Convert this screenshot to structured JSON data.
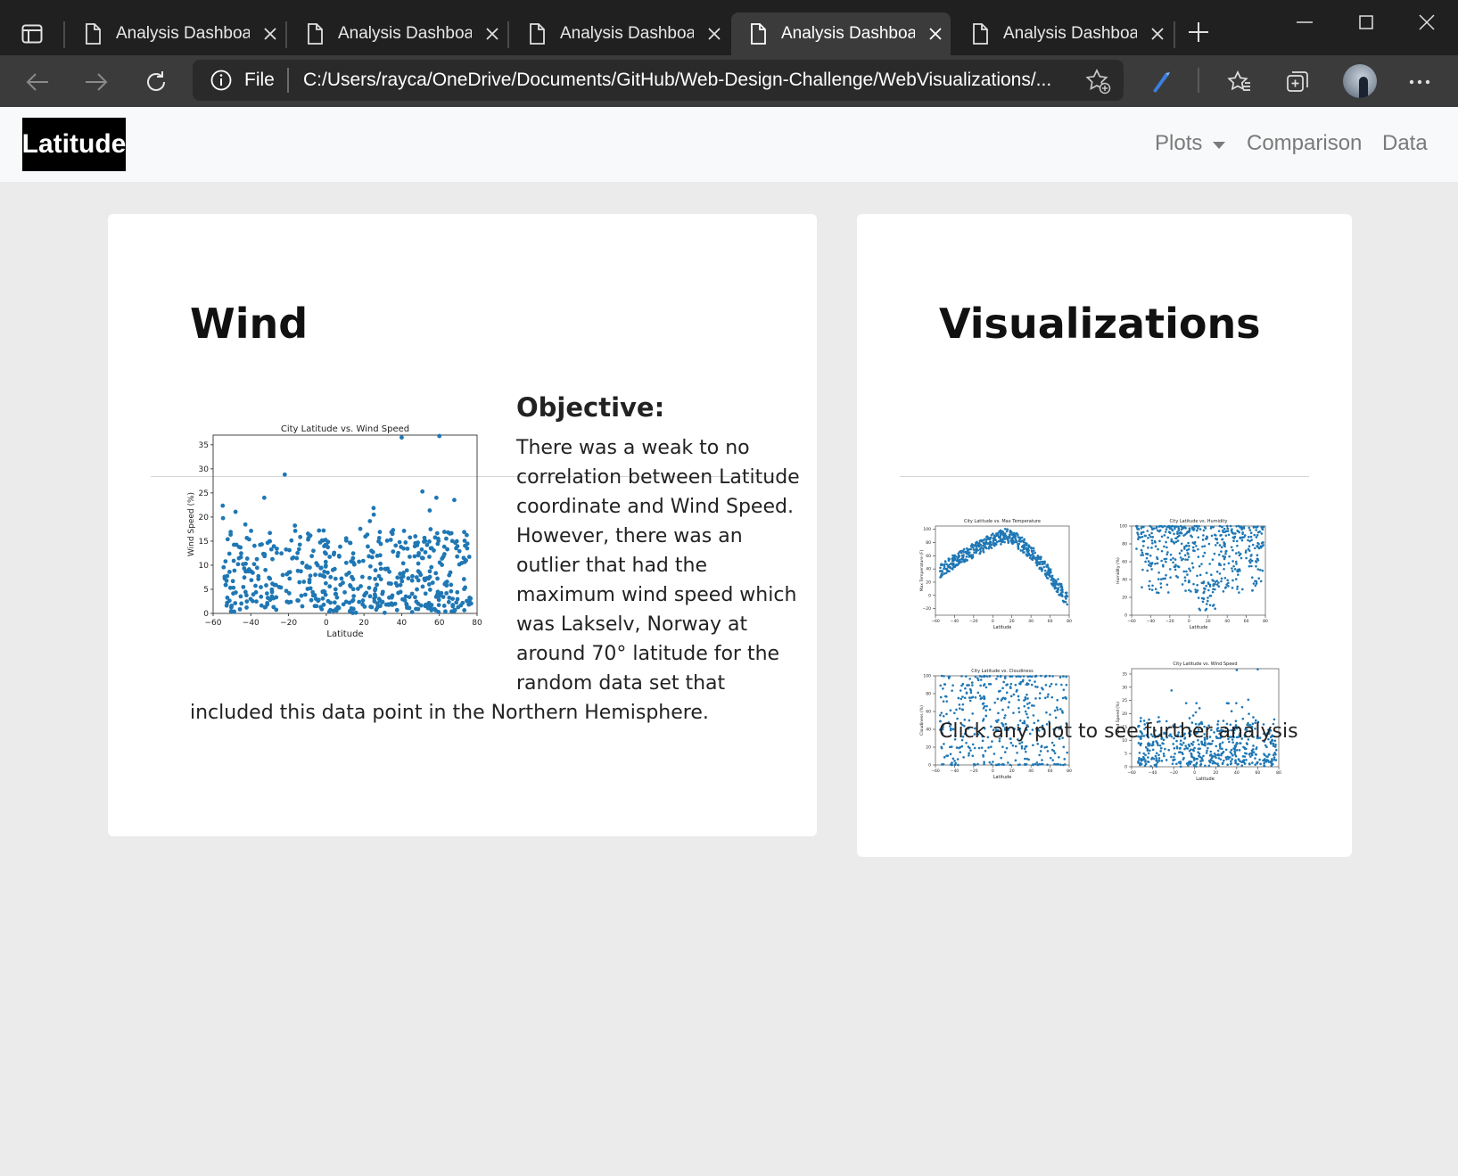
{
  "browser": {
    "tabs": [
      {
        "title": "Analysis Dashboard",
        "active": false
      },
      {
        "title": "Analysis Dashboard",
        "active": false
      },
      {
        "title": "Analysis Dashboard",
        "active": false
      },
      {
        "title": "Analysis Dashboard",
        "active": true
      },
      {
        "title": "Analysis Dashboard",
        "active": false
      }
    ],
    "address": {
      "scheme_label": "File",
      "url": "C:/Users/rayca/OneDrive/Documents/GitHub/Web-Design-Challenge/WebVisualizations/..."
    }
  },
  "navbar": {
    "brand": "Latitude",
    "links": {
      "plots": "Plots",
      "comparison": "Comparison",
      "data": "Data"
    }
  },
  "wind_card": {
    "title": "Wind",
    "objective_heading": "Objective:",
    "description_lines": [
      "There was a weak to no",
      "correlation between Latitude",
      "coordinate and Wind Speed.",
      "However, there was an",
      "outlier that had the",
      "maximum wind speed which",
      "was Lakselv, Norway at",
      "around 70° latitude for the",
      "random data set that",
      "included this data point in the Northern Hemisphere."
    ]
  },
  "viz_card": {
    "title": "Visualizations",
    "hint": "Click any plot to see further analysis"
  },
  "colors": {
    "point": "#1f77b4",
    "brand_bg": "#000000",
    "navbar_bg": "#f8f9fa",
    "page_bg": "#ebebeb"
  },
  "chart_data": [
    {
      "type": "scatter",
      "title": "City Latitude vs. Wind Speed",
      "xlabel": "Latitude",
      "ylabel": "Wind Speed (%)",
      "xlim": [
        -60,
        80
      ],
      "ylim": [
        0,
        37
      ],
      "xticks": [
        -60,
        -40,
        -20,
        0,
        20,
        40,
        60,
        80
      ],
      "yticks": [
        0,
        5,
        10,
        15,
        20,
        25,
        30,
        35
      ],
      "outliers": [
        [
          40,
          36.5
        ],
        [
          60,
          36.8
        ],
        [
          -22,
          28.8
        ],
        [
          51,
          25.3
        ]
      ],
      "series": [
        {
          "points": "approx. 550 city observations, wind speed mostly 0–20 across latitude -55 to 78"
        }
      ]
    },
    {
      "type": "scatter",
      "title": "City Latitude vs. Max Temperature",
      "xlabel": "Latitude",
      "ylabel": "Max Temperature (F)",
      "xlim": [
        -60,
        80
      ],
      "ylim": [
        -30,
        105
      ],
      "xticks": [
        -60,
        -40,
        -20,
        0,
        20,
        40,
        60,
        80
      ],
      "yticks": [
        -20,
        0,
        20,
        40,
        60,
        80,
        100
      ],
      "trend": "peaks near 90–100 around latitude 10, falls to about -10 near latitude 75"
    },
    {
      "type": "scatter",
      "title": "City Latitude vs. Humidity",
      "xlabel": "Latitude",
      "ylabel": "Humidity (%)",
      "xlim": [
        -60,
        80
      ],
      "ylim": [
        0,
        100
      ],
      "xticks": [
        -60,
        -40,
        -20,
        0,
        20,
        40,
        60,
        80
      ],
      "yticks": [
        0,
        20,
        40,
        60,
        80,
        100
      ],
      "trend": "mostly 60–100 with scattered lows near 10–40"
    },
    {
      "type": "scatter",
      "title": "City Latitude vs. Cloudiness",
      "xlabel": "Latitude",
      "ylabel": "Cloudiness (%)",
      "xlim": [
        -60,
        80
      ],
      "ylim": [
        0,
        100
      ],
      "xticks": [
        -60,
        -40,
        -20,
        0,
        20,
        40,
        60,
        80
      ],
      "yticks": [
        0,
        20,
        40,
        60,
        80,
        100
      ],
      "trend": "clustered at 0, 20, 40, 75, 90 and 100"
    },
    {
      "type": "scatter",
      "title": "City Latitude vs. Wind Speed",
      "xlabel": "Latitude",
      "ylabel": "Wind Speed (%)",
      "xlim": [
        -60,
        80
      ],
      "ylim": [
        0,
        37
      ],
      "xticks": [
        -60,
        -40,
        -20,
        0,
        20,
        40,
        60,
        80
      ],
      "yticks": [
        0,
        5,
        10,
        15,
        20,
        25,
        30,
        35
      ]
    }
  ]
}
